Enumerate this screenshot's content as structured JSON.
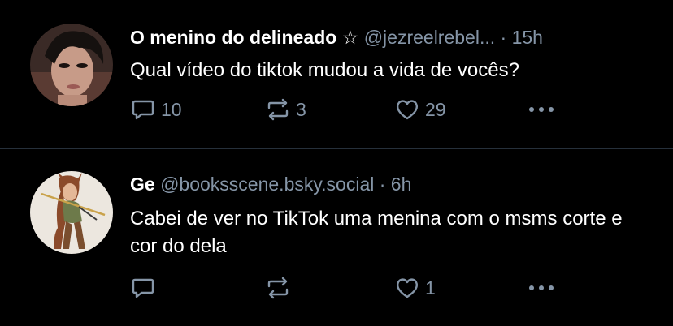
{
  "posts": [
    {
      "author": {
        "display_name": "O menino do delineado ☆",
        "handle": "@jezreelrebel..."
      },
      "separator": "·",
      "time": "15h",
      "text": "Qual vídeo do tiktok mudou a vida de vocês?",
      "reply_count": "10",
      "repost_count": "3",
      "like_count": "29",
      "avatar_icon": "avatar-photo"
    },
    {
      "author": {
        "display_name": "Ge",
        "handle": "@booksscene.bsky.social"
      },
      "separator": "·",
      "time": "6h",
      "text": "Cabei de ver no TikTok uma menina com o msms corte e cor do dela",
      "reply_count": "",
      "repost_count": "",
      "like_count": "1",
      "avatar_icon": "avatar-illustration"
    }
  ],
  "icons": {
    "reply": "reply-icon",
    "repost": "repost-icon",
    "like": "heart-icon",
    "more": "more-icon"
  },
  "colors": {
    "background": "#000000",
    "muted": "#8595a7",
    "text": "#ffffff",
    "divider": "#26303b"
  }
}
